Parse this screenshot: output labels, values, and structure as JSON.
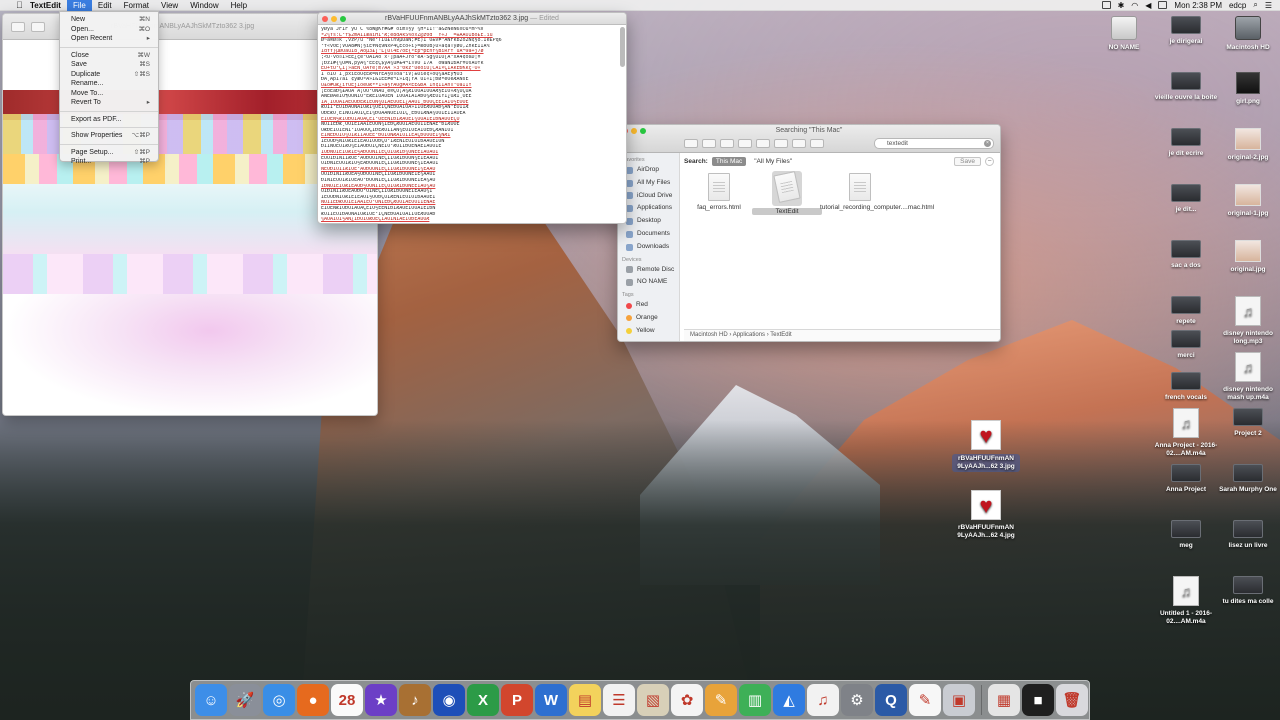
{
  "menubar": {
    "apple": "",
    "app_name": "TextEdit",
    "menus": [
      "File",
      "Edit",
      "Format",
      "View",
      "Window",
      "Help"
    ],
    "clock": "Mon 2:38 PM",
    "user": "edcp"
  },
  "file_menu": {
    "items": [
      {
        "label": "New",
        "shortcut": "⌘N"
      },
      {
        "label": "Open...",
        "shortcut": "⌘O"
      },
      {
        "label": "Open Recent",
        "shortcut": "▸"
      },
      {
        "sep": true
      },
      {
        "label": "Close",
        "shortcut": "⌘W"
      },
      {
        "label": "Save",
        "shortcut": "⌘S"
      },
      {
        "label": "Duplicate",
        "shortcut": "⇧⌘S"
      },
      {
        "label": "Rename...",
        "shortcut": ""
      },
      {
        "label": "Move To...",
        "shortcut": ""
      },
      {
        "label": "Revert To",
        "shortcut": "▸"
      },
      {
        "sep": true
      },
      {
        "label": "Export as PDF...",
        "shortcut": ""
      },
      {
        "sep": true
      },
      {
        "label": "Show Properties",
        "shortcut": "⌥⌘P"
      },
      {
        "sep": true
      },
      {
        "label": "Page Setup...",
        "shortcut": "⇧⌘P"
      },
      {
        "label": "Print...",
        "shortcut": "⌘P"
      }
    ]
  },
  "preview_window": {
    "title": "rBVaHFUUFnmANBLyAAJhSkMTzto362 3.jpg"
  },
  "textedit_window": {
    "title": "rBVaHFUUFnmANBLyAAJhSkMTzto362 3.jpg",
    "edited": "— Edited",
    "lines": [
      "ÿØÿà JFIF  ÿÛ C  %8W@Kr#&# òîm¤§ÿ ¼HºÍÌ!^a&zNèÑ6x©ùºm~%V",
      "ª2¼Ys:L¹f$2mÀÍÏæåïHÌ²Æ;ë8dÄkS%ôxZ@z0d¯´Ý÷J¨¯=±ÀÃÕÌBó£È.ïü",
      "Ø~à®Ø¤k¨,vzP/ù´°Ñè¹TÍù£lñ9µÚàÑ;ÞË)Í¨Ó±vÞ³ÀÑFkb2ò2Ñ¢§ð.Ìë£Pq6",
      "¹f«v0Ë¦VÕÁ8#Ñ¦§ïÊ¥N¢9ÑxP4ÇÈcõ÷ï}=æðÖB}Û»å¢ãTÿøÙ,ZhkÊÎÌÁ%",
      "ÎdYÝ}µØUàuÌ8¸Áöµ3£]\"L[Úl4Ë7óÈ{ºÉp¬pÉnf¼BìRrf¨ùÄ¬9â+j7ø",
      ";<Û·vö¤Í»ÈË¿çé°ÓÃ1Åo¨x·]þäÁ+JÝô²êÃ·Sg¾ÓÌÓ[Ã¹xÂ4¢õßD¦¥",
      "¡ÐzÍ#{¼ÖÞÑ,pÿÂ¾²ÈE¢Ç$ÿÄ¼uÞ±4¬Í¤VÖ¨Ï7À´¯oWãNÎÐÀr¥ÔsÅÒfk",
      "ÈÜ+tU²ÇÍ¡»åËÑ¸ÜÄYé¦m7ÃÂ´»3\"0kz¹ÛèòïÛ¡CÃÌ×ÇÏÁkÊÐKkç·Õ«",
      "Ì¨óÍÓ¯Î¸pxiÈðÖ¢ÊÆ=ÑÝÉÅ§0¤óà³ìV¦±Ôîê¢»óQ¼âÀÉÿ¶Ô3",
      "ÐÄ¸ÃþÍ7áÎ´¢ÿæÖºÃ»Î&1ÈÉÞè¬Ï»Ïq¡ÝÁ´ÜÏ«Í¦ÐØªêÖéÆÅÑsÈ",
      "Û£õ#ûÆ¿ïÝÛÈjÍôéÛÆªª1»ä§rÃÖgÞÅ×ÈÈ&ÐÀ´Ìñ¢ÏÌÂñ¤¹ÕàÍÏÝ",
      "¡ÊõÈåÐ¾£ÄÙÄ´Â¡ÔÓ¹ÖÑÀú¸é®ÇÒ¡Ã¾ÆÏÒÓÄÍÓÕÁÆ§ÉÍÒ»Æ¼ÚÇÒÃ",
      "ÂÑÈØÀëÍÓ¶ÒÙÑÎÕ°ËÆÉÎÜÄÖÉÑ¨ÍÕÒÄÌÂÏÁÐÓ¼ÆÉÖÏÝÎ¿ÚÆÍ¸ÓÉË",
      "ÎÄ¸ÍÒÔÃÏÁÉÛÕÐÈÆÌÊÓÑ¼ÖÎÁÈÓÕÊÍ¿ÃÄÒÎ¸ÐÖÔÇÊËÌÁÏÓ½ÈÖÕÉ",
      "ÆÒÍÏ¹ÊÕÌÐÃÓÑÅÎÖÆÍ¼ÔÈÎÇÑÊÐÖÄÌÓÁ»ÏÍÒÈÆÖÓÃÐ¼ÅÑ¹ÊÔÍÏÆ",
      "ÒÐÈÆÓ¸ËÎÑÖÍÄÔÏÇÊÌ¼ÐÒÃÅÑÖÈÍÓÎÇ¸ÊÐÔÏÆÑÃ¼ÖÓÌÉÍÎÅÒÈÄ",
      "ÈÏÓÊÑ½ÆÍÔÐÖÌÃÒÅÇËÎ¹ÓÈÉÑÍÐÏÆÄÖÊÌ¼ÒÓÁÍÈÎÐÑÅÔÖÉÇÓ",
      "ÑÖÎÍÈÐÆ¸ÓÒÌÊÏÄÅÍÉÖÓÑ¼ÎÈÐÇÆÔÒÌÃËÖÓÍÏÊÑÅÈ¹ÐÎÆÒÔÉ",
      "ÓÆÐÊÍÖÌÈÑÏ¹ÎÒÅÔÓÇÍÐÈÆÖÌÏÃÑ¼ÊÒÎÓÉÅÍÖÈÐÇÆÄÑÏÒÎ",
      "ÊÌÑÈÐÒÎÖ¼ÓÏÆÍÍÅÔÉÈ¹ÐÖÏÓÑÆÃÌÒÍÎÈÅÇÐÔÓÖÊÏ¼ÑÆÍ",
      "ÍÈÒÖÐ½ÑÏÓÆÎÊÌÈÅÔÍÓÖÐÇÒ¹ÏÆÉÑÎÈÓÍÖÌÐÃÅÒÊÏÔÑ",
      "ÐÏÌÑÒÈÖÎÆÓ¼ÊÍÅÔÐÖÏÇÑÈÎÓ¹ÆÒÍÌÐÖÈÑÃÊÏÅÔÓÎÉ",
      "ÎÒÐÑÖÌÈÏÓÆÍÊ½ÅÐÔÖÑÎÏÈÇÓÍÒÆÌÐ¼ÖÑÈÊÏÃÓÅÔÎ",
      "ÈÖÓÏÐÍÑÎÌÆÒÊ¹ÅÔÐÓÖÏÑÈÇÎÍÒÆÌÐÖÓÑ¼ÈÏÊÃÅÔÎ",
      "ÔÍÐÑÏÈÖÓÎÆÌÒ½ÊÅÐÓÖÑÏÈÇÍÎÒÆÌÐÓÖÑÈ¼ÏÊÃÅÔÎ",
      "ÑÈÖÐÏÓÍÎÆÌÒÊ¹ÅÔÐÓÖÑÏÈÇÎÍÒÆÌÐÓÖÑÈÏ¼ÊÃÅÔ",
      "ÖÓÏÐÍÑÎÌÆÒÊÅ½ÔÐÓÖÏÑÈÇÎÍÒÆÌÐÖÓÑÈÏÊ¼ÃÅÔÎ",
      "ÐÍÑÏÈÖÓÎÆÌÒÊÅÔ¹ÐÓÖÑÏÈÇÍÎÒÆÌÐÓÖÑÈÏÊÃ¼ÅÔ",
      "ÎÐÑÖÌÈÏÓÆÍÊÅÔÐ½ÓÖÑÎÏÈÇÓÍÒÆÌÐÖÑÈÊÏÃÓ¼ÅÔ",
      "ÓÏÐÍÑÎÌÆÒÊÅÔÐÓ¹ÖÏÑÈÇÎÍÒÆÌÐÖÓÑÈÏÊÃÅÔ¼Î",
      "ÍÈÒÖÐÑÏÓÆÎÊÌÈÅÔÍ½ÓÖÐÇÒÏÆÉÑÎÈÓÍÖÌÐÃÅÒÊÏ",
      "ÑÖÎÍÈÐÆÓÒÌÊÏÄÅÍÉÖ¹ÓÑÎÈÐÇÆÔÒÌÃËÖÓÍÏÊÑÅÈ",
      "ÈÏÓÊÑÆÍÔÐÖÌÃÒÅÇËÎÓ½ÈÉÑÍÐÏÆÄÖÊÌÒÓÁÍÈÎÐÑ",
      "ÆÒÍÏÊÕÌÐÃÓÑÅÎÖÆÍÔÈ¹ÎÇÑÊÐÖÄÌÓÁÏÍÒÈÆÖÓÃÐ",
      "¼ÄÖÂÎÓÏ½ÃÑ¿ÌÐÒÍÔÆÕÉÇÎÅÖÎÑÏÄÈÌÓÐÊÁÒÕÆ",
      "ÝÍÃÎÊÒÔÕÖ¸ÏÈÑÐÌÓÆÅÇÁÉÎÄÑÏÍÖÒÊÔÐÈÓÆÌÃ"
    ]
  },
  "finder_window": {
    "title": "Searching \"This Mac\"",
    "search_value": "textedit",
    "scope_label": "Search:",
    "scope_this_mac": "This Mac",
    "scope_all_files": "\"All My Files\"",
    "save_label": "Save",
    "favorites_head": "Favorites",
    "favorites": [
      "AirDrop",
      "All My Files",
      "iCloud Drive",
      "Applications",
      "Desktop",
      "Documents",
      "Downloads"
    ],
    "devices_head": "Devices",
    "devices": [
      "Remote Disc",
      "NO NAME"
    ],
    "tags_head": "Tags",
    "tags": [
      {
        "label": "Red",
        "color": "#f0484a"
      },
      {
        "label": "Orange",
        "color": "#f6a23c"
      },
      {
        "label": "Yellow",
        "color": "#f4d03b"
      }
    ],
    "files": [
      "faq_errors.html",
      "TextEdit",
      "tutorial_recording_computer....mac.html"
    ],
    "path": [
      "Macintosh HD",
      "Applications",
      "TextEdit"
    ]
  },
  "desktop_icons": [
    {
      "label": "NO NAME",
      "kind": "disk"
    },
    {
      "label": "je dirigerai",
      "kind": "folder-dark"
    },
    {
      "label": "Macintosh HD",
      "kind": "hdd"
    },
    {
      "label": "vieille ouvre la boite",
      "kind": "folder-dark"
    },
    {
      "label": "girl.png",
      "kind": "photo-dark"
    },
    {
      "label": "je dit ecrire",
      "kind": "folder-dark"
    },
    {
      "label": "original-2.jpg",
      "kind": "photo"
    },
    {
      "label": "je dit...",
      "kind": "folder-dark"
    },
    {
      "label": "original-1.jpg",
      "kind": "photo"
    },
    {
      "label": "sac a dos",
      "kind": "folder-dark"
    },
    {
      "label": "original.jpg",
      "kind": "photo"
    },
    {
      "label": "repete",
      "kind": "folder-dark"
    },
    {
      "label": "merci",
      "kind": "folder-dark"
    },
    {
      "label": "disney nintendo long.mp3",
      "kind": "music"
    },
    {
      "label": "french vocals",
      "kind": "folder-dark"
    },
    {
      "label": "disney nintendo mash up.m4a",
      "kind": "music"
    },
    {
      "label": "Anna Project - 2016-02....AM.m4a",
      "kind": "music"
    },
    {
      "label": "Project 2",
      "kind": "folder-dark"
    },
    {
      "label": "Anna Project",
      "kind": "folder-dark"
    },
    {
      "label": "Sarah Murphy One",
      "kind": "folder-dark"
    },
    {
      "label": "meg",
      "kind": "folder-dark"
    },
    {
      "label": "lisez un livre",
      "kind": "folder-dark"
    },
    {
      "label": "Untitled 1 - 2016-02....AM.m4a",
      "kind": "music"
    },
    {
      "label": "tu dites ma colle",
      "kind": "folder-dark"
    },
    {
      "label": "rBVaHFUUFnmAN 9LyAAJh...62 3.jpg",
      "kind": "heart",
      "selected": true
    },
    {
      "label": "rBVaHFUUFnmAN 9LyAAJh...62 4.jpg",
      "kind": "heart"
    }
  ],
  "dock": [
    {
      "name": "Finder",
      "glyph": "☺",
      "bg": "#3d8ee8"
    },
    {
      "name": "Launchpad",
      "glyph": "🚀",
      "bg": "#8a8f99"
    },
    {
      "name": "Safari",
      "glyph": "◎",
      "bg": "#3a8ee6"
    },
    {
      "name": "Firefox",
      "glyph": "●",
      "bg": "#e66a1e"
    },
    {
      "name": "Calendar",
      "glyph": "28",
      "bg": "#fafafa"
    },
    {
      "name": "iMovie",
      "glyph": "★",
      "bg": "#6c3fc6"
    },
    {
      "name": "GarageBand",
      "glyph": "♪",
      "bg": "#a87033"
    },
    {
      "name": "Audacity",
      "glyph": "◉",
      "bg": "#1e4fb8"
    },
    {
      "name": "Excel",
      "glyph": "X",
      "bg": "#2c9b47"
    },
    {
      "name": "PowerPoint",
      "glyph": "P",
      "bg": "#d2462d"
    },
    {
      "name": "Word",
      "glyph": "W",
      "bg": "#2e6fd0"
    },
    {
      "name": "Stickies",
      "glyph": "▤",
      "bg": "#f3d25c"
    },
    {
      "name": "Reminders",
      "glyph": "☰",
      "bg": "#f2f2f2"
    },
    {
      "name": "Preview",
      "glyph": "▧",
      "bg": "#d8d0b8"
    },
    {
      "name": "Photos",
      "glyph": "✿",
      "bg": "#f4f4f4"
    },
    {
      "name": "Pages",
      "glyph": "✎",
      "bg": "#e8a33a"
    },
    {
      "name": "Numbers",
      "glyph": "▥",
      "bg": "#3eb057"
    },
    {
      "name": "Keynote",
      "glyph": "◭",
      "bg": "#2f7be0"
    },
    {
      "name": "iTunes",
      "glyph": "♫",
      "bg": "#f2f2f2"
    },
    {
      "name": "System Preferences",
      "glyph": "⚙",
      "bg": "#7f8288"
    },
    {
      "name": "QuickTime Player",
      "glyph": "Q",
      "bg": "#2b5aa6"
    },
    {
      "name": "TextEdit",
      "glyph": "✎",
      "bg": "#f7f7f7"
    },
    {
      "name": "Image Capture",
      "glyph": "▣",
      "bg": "#c9ccd2"
    },
    {
      "name": "Documents stack",
      "glyph": "▦",
      "bg": "#e5e5e5"
    },
    {
      "name": "Screen Recording",
      "glyph": "■",
      "bg": "#1f1f1f"
    },
    {
      "name": "Trash",
      "glyph": "🗑",
      "bg": "#d9d9dd"
    }
  ]
}
